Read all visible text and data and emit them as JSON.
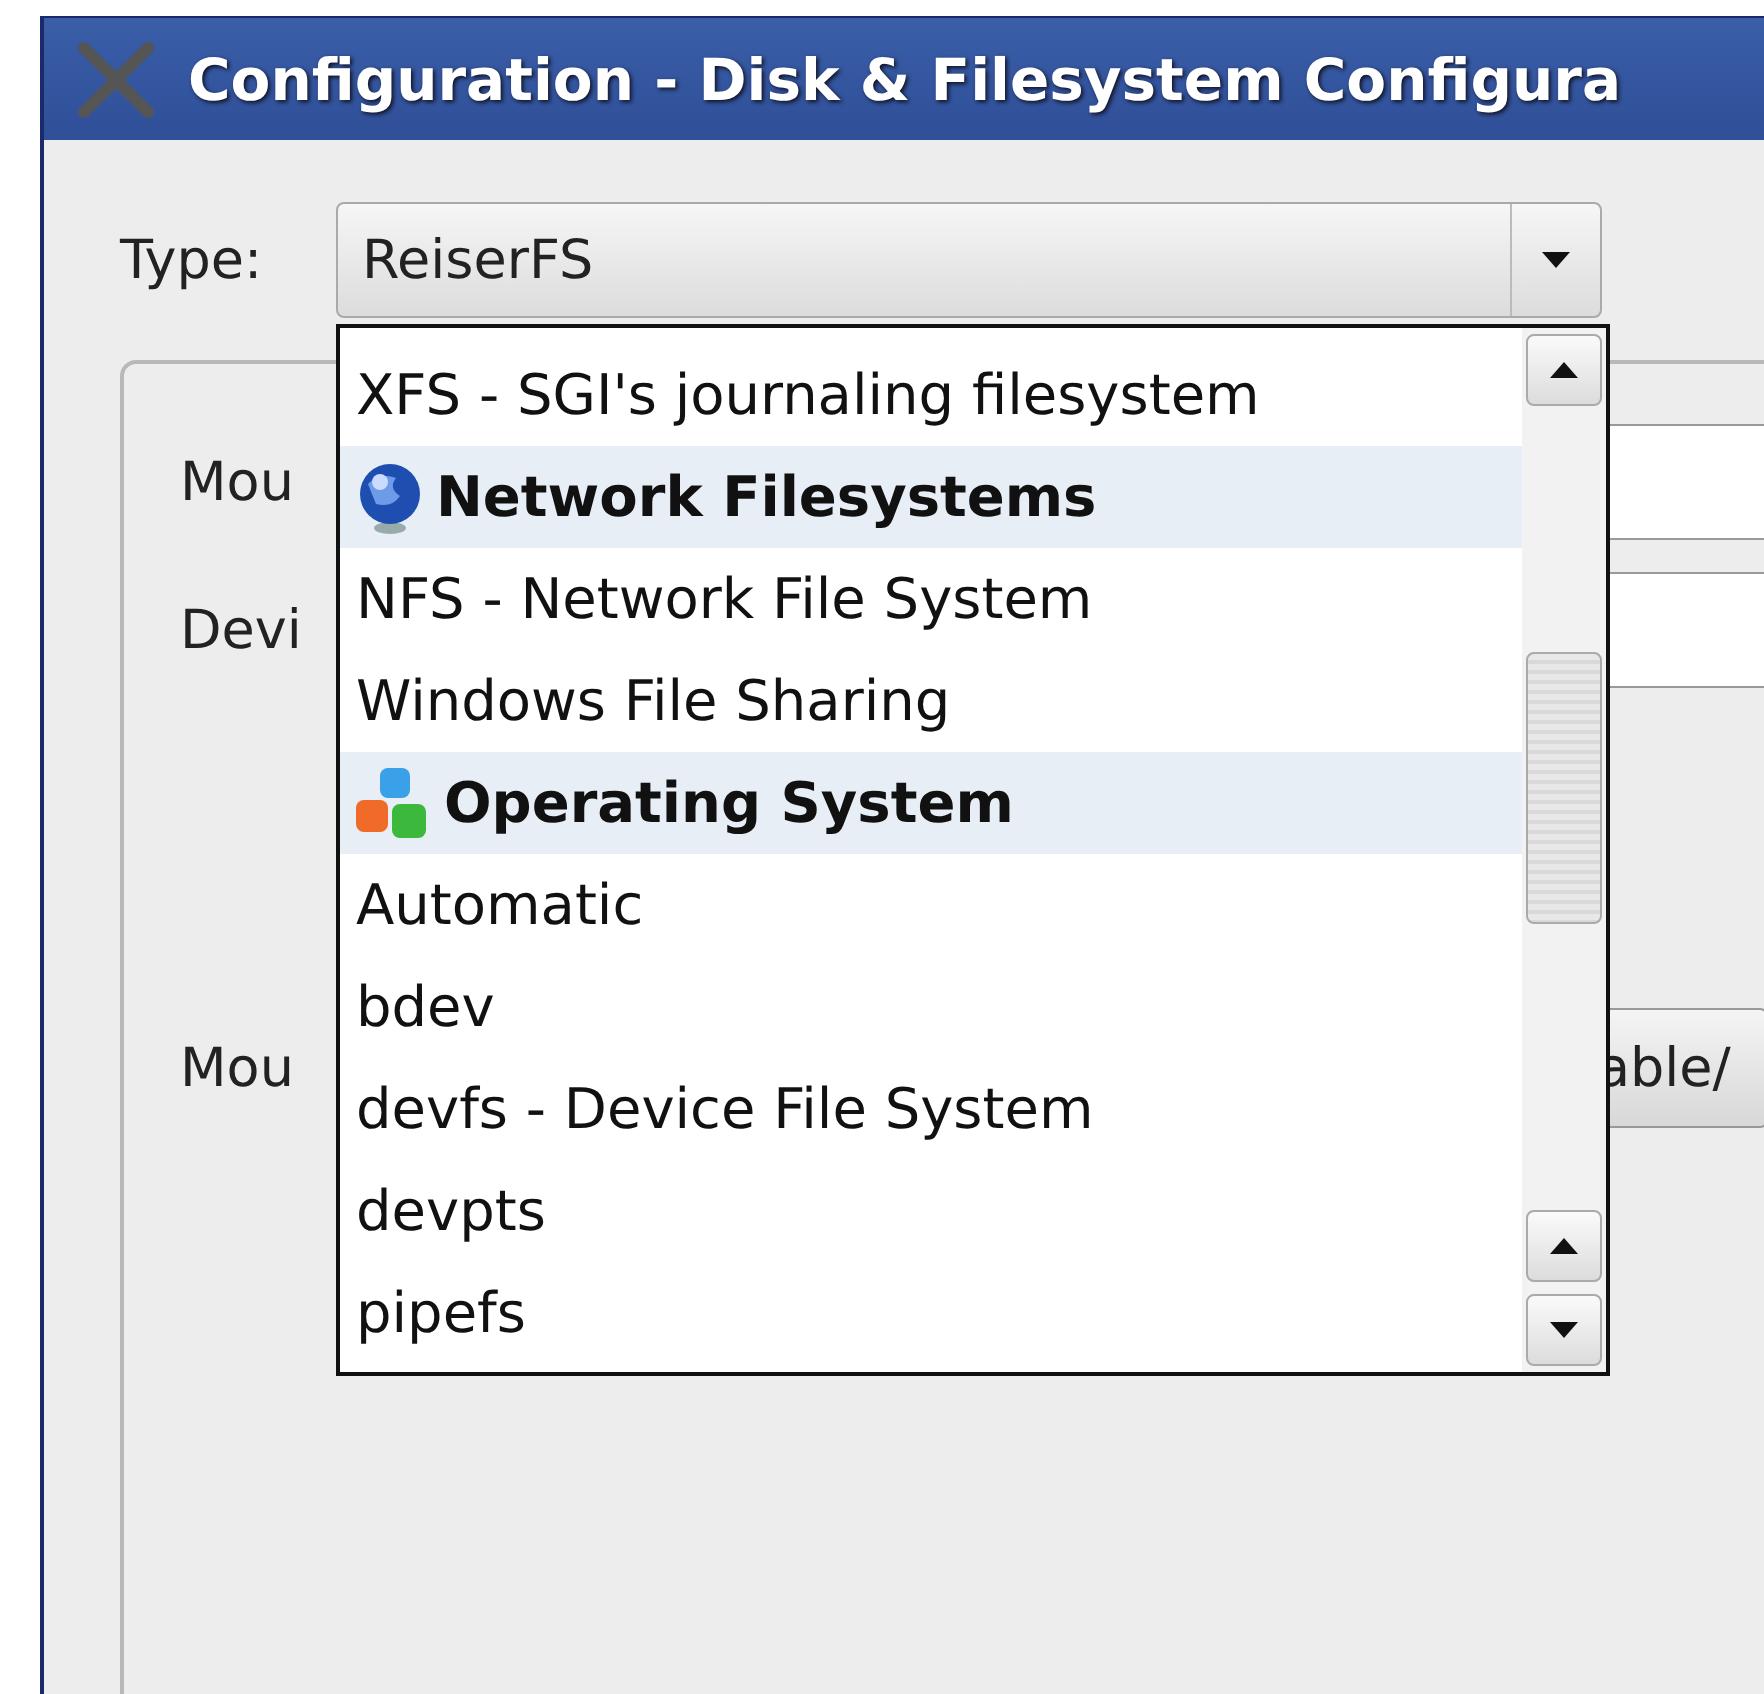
{
  "window": {
    "title": "Configuration - Disk & Filesystem Configura"
  },
  "type_field": {
    "label": "Type:",
    "value": "ReiserFS"
  },
  "form_rows": [
    {
      "kind": "field",
      "label": "Mou"
    },
    {
      "kind": "field",
      "label": "Devi"
    },
    {
      "kind": "button",
      "label": "Mou",
      "button": "able/"
    }
  ],
  "dropdown_list": {
    "items": [
      {
        "kind": "option",
        "text": "XFS - SGI's journaling filesystem"
      },
      {
        "kind": "header",
        "text": "Network Filesystems"
      },
      {
        "kind": "option",
        "text": "NFS - Network File System"
      },
      {
        "kind": "option",
        "text": "Windows File Sharing"
      },
      {
        "kind": "header",
        "text": "Operating System"
      },
      {
        "kind": "option",
        "text": "Automatic"
      },
      {
        "kind": "option",
        "text": "bdev"
      },
      {
        "kind": "option",
        "text": "devfs - Device File System"
      },
      {
        "kind": "option",
        "text": "devpts"
      },
      {
        "kind": "option",
        "text": "pipefs"
      }
    ]
  }
}
